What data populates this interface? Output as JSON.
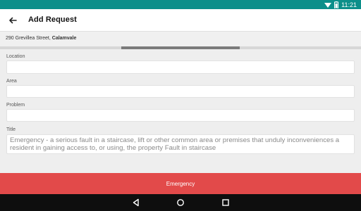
{
  "status_bar": {
    "time": "11:21"
  },
  "app_bar": {
    "title": "Add Request"
  },
  "address": {
    "street": "290 Grevillea Street, ",
    "suburb": "Calamvale"
  },
  "form": {
    "location_label": "Location",
    "location_value": "",
    "area_label": "Area",
    "area_value": "",
    "problem_label": "Problem",
    "problem_value": "",
    "title_label": "Title",
    "title_value": "Emergency - a serious fault in a staircase, lift or other common area or premises that unduly inconveniences a resident in gaining access to, or using, the property Fault in staircase"
  },
  "action_button": {
    "label": "Emergency"
  },
  "colors": {
    "status_bar": "#0c8f8a",
    "action_button": "#e24a4a",
    "nav_bar": "#0e0e0e"
  }
}
